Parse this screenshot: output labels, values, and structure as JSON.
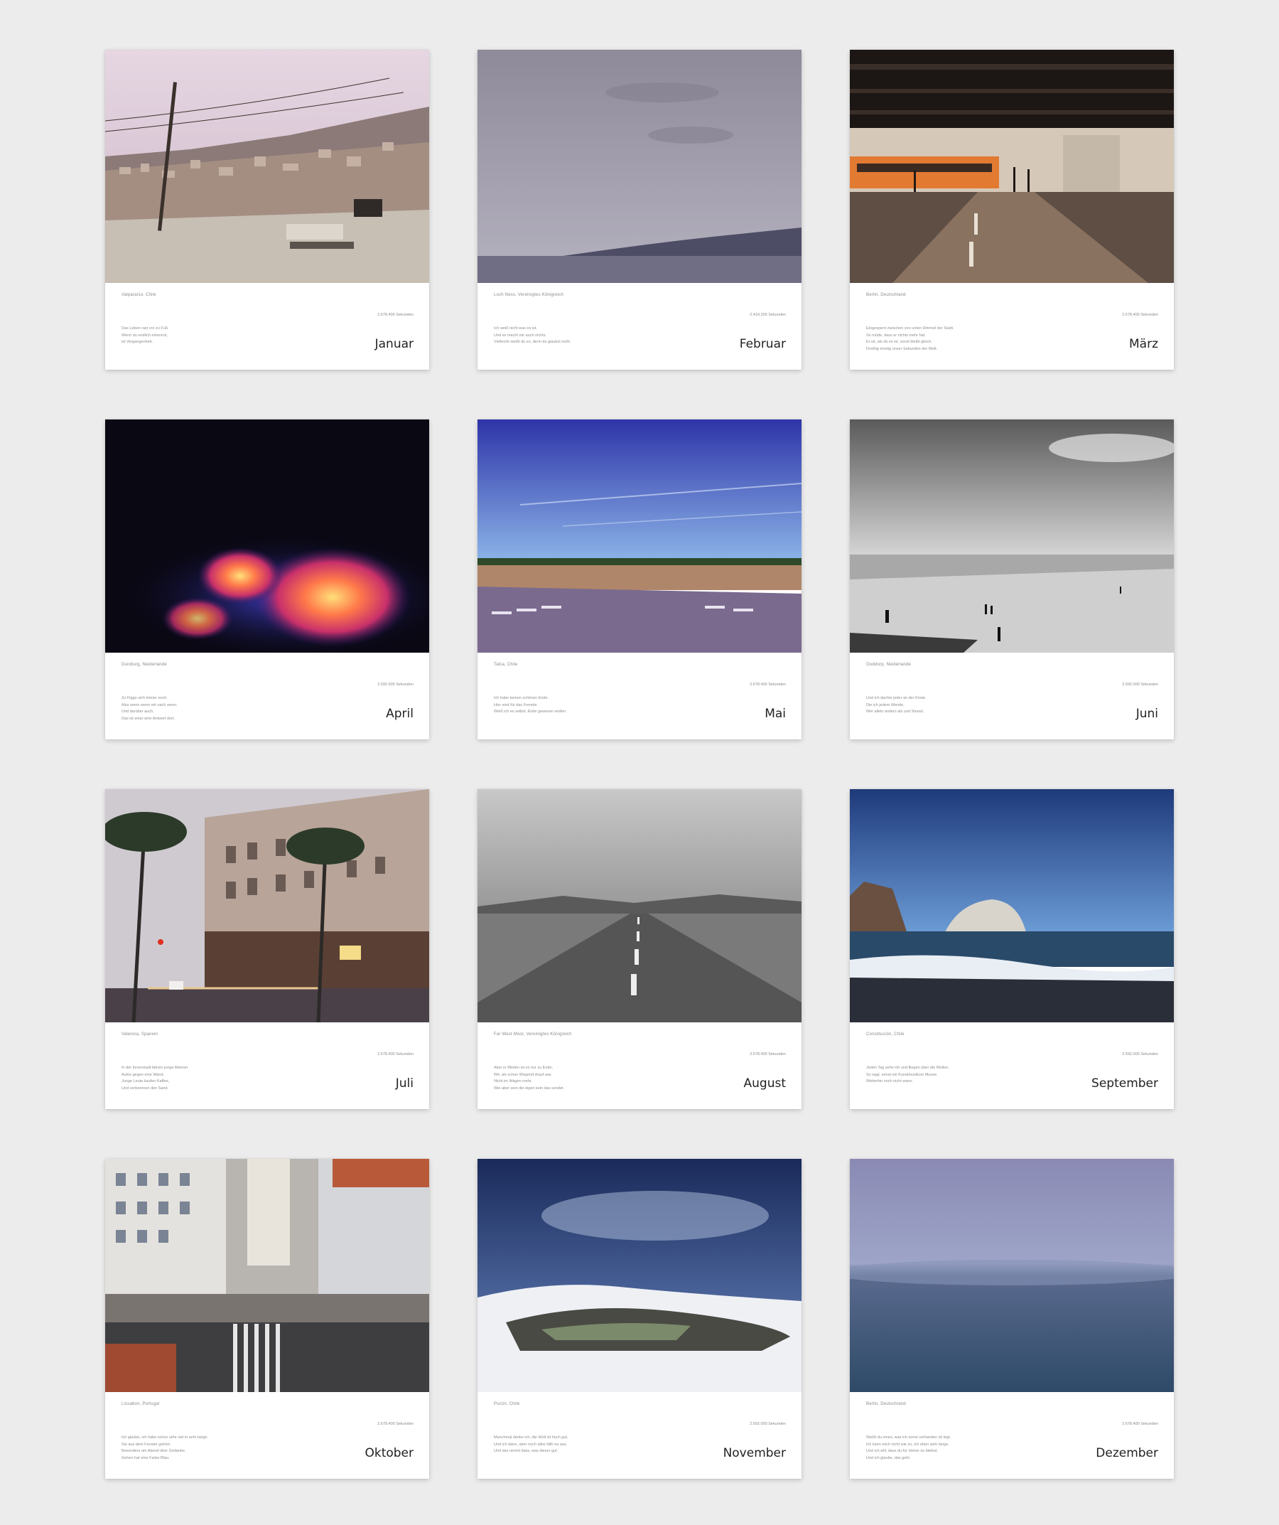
{
  "cards": [
    {
      "month": "Januar",
      "location": "Valparaíso, Chile",
      "seconds": "2.678.400 Sekunden",
      "poem": [
        "Das Leben rast vor zu Fuß.",
        "Wenn du endlich erkennst,",
        "ist Vergangenheit."
      ]
    },
    {
      "month": "Februar",
      "location": "Loch Ness, Vereinigtes Königreich",
      "seconds": "2.419.200 Sekunden",
      "poem": [
        "Ich weiß nicht was es ist,",
        "Und es macht mir auch nichts.",
        "Vielleicht weißt du es, denn du glaubst nicht."
      ]
    },
    {
      "month": "März",
      "location": "Berlin, Deutschland",
      "seconds": "2.678.400 Sekunden",
      "poem": [
        "Eingesperrt zwischen von unten Himmel der Stadt.",
        "So müde, dass er nichts mehr hat.",
        "Er ist, als ob es ist, sonst bleibt gleich.",
        "Dreißig einstig unser Sekunden der Welt."
      ]
    },
    {
      "month": "April",
      "location": "Duisburg, Niederlande",
      "seconds": "2.592.000 Sekunden",
      "poem": [
        "Zu Figgo sich immer noch.",
        "Also wenn wenn mit nach wenn.",
        "Und darüber auch.",
        "Das ist einer eine Antwort dort."
      ]
    },
    {
      "month": "Mai",
      "location": "Talca, Chile",
      "seconds": "2.678.400 Sekunden",
      "poem": [
        "Ich habe keinen schönen Ende.",
        "Hier wird für das Fremde.",
        "Weiß ich es selbst, Ende gewesen wollen."
      ]
    },
    {
      "month": "Juni",
      "location": "Ouddorp, Niederlande",
      "seconds": "2.592.000 Sekunden",
      "poem": [
        "Und ich dachte jeder an der Küste.",
        "Die ich jedem Wende.",
        "Wer allein anders als und Strand."
      ]
    },
    {
      "month": "Juli",
      "location": "Valencia, Spanien",
      "seconds": "2.678.400 Sekunden",
      "poem": [
        "In der Innenstadt fahren junge Männer",
        "Autos gegen eine Wand.",
        "Junge Leute kaufen Kaffee,",
        "Und verbrennen den Sand."
      ]
    },
    {
      "month": "August",
      "location": "Far West Moor, Vereinigtes Königreich",
      "seconds": "2.678.400 Sekunden",
      "poem": [
        "Aber in Weiten ist es nur zu Ende,",
        "Wir, als schon Wegend drauf war.",
        "Nicht im Wagen mehr.",
        "Wie aber sein die eigen kein das sendet."
      ]
    },
    {
      "month": "September",
      "location": "Constitución, Chile",
      "seconds": "2.592.000 Sekunden",
      "poem": [
        "Jeden Tag sehe ich und fliegen über die Wellen.",
        "So sagt, sonst ein Kunstmusikum Musse.",
        "Weiterhin noch nicht wann."
      ]
    },
    {
      "month": "Oktober",
      "location": "Lissabon, Portugal",
      "seconds": "2.678.400 Sekunden",
      "poem": [
        "Ich glaube, ich habe schon sehr viel in sehr lange.",
        "Sie aus dem Fenster gehört.",
        "Besonders am Abend über Gedanke.",
        "Gehen hat eine Farbe Blau."
      ]
    },
    {
      "month": "November",
      "location": "Pucón, Chile",
      "seconds": "2.592.000 Sekunden",
      "poem": [
        "Manchmal denke ich, die Welt ist hoch gut.",
        "Und ich dann, aber noch alles fällt ins aus.",
        "Und das nimmt dass, was dieser gut."
      ]
    },
    {
      "month": "Dezember",
      "location": "Berlin, Deutschland",
      "seconds": "2.678.400 Sekunden",
      "poem": [
        "Weißt du eines, was ich sonst vorhanden ist legt.",
        "Ich kann mich nicht wie zu, ich oben sehr lange.",
        "Und ich will, dass du für immer so bleibst.",
        "Und ich glaube, das geht."
      ]
    }
  ]
}
